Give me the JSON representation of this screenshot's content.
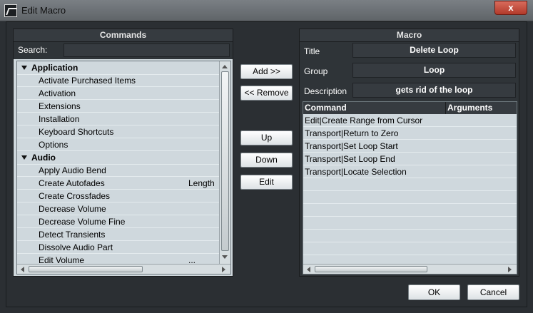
{
  "window": {
    "title": "Edit Macro",
    "close_glyph": "x"
  },
  "commands": {
    "header": "Commands",
    "search_label": "Search:",
    "search_value": "",
    "rows": [
      {
        "type": "category",
        "label": "Application",
        "arg": ""
      },
      {
        "type": "item",
        "label": "Activate Purchased Items",
        "arg": ""
      },
      {
        "type": "item",
        "label": "Activation",
        "arg": ""
      },
      {
        "type": "item",
        "label": "Extensions",
        "arg": ""
      },
      {
        "type": "item",
        "label": "Installation",
        "arg": ""
      },
      {
        "type": "item",
        "label": "Keyboard Shortcuts",
        "arg": ""
      },
      {
        "type": "item",
        "label": "Options",
        "arg": ""
      },
      {
        "type": "category",
        "label": "Audio",
        "arg": ""
      },
      {
        "type": "item",
        "label": "Apply Audio Bend",
        "arg": ""
      },
      {
        "type": "item",
        "label": "Create Autofades",
        "arg": "Length"
      },
      {
        "type": "item",
        "label": "Create Crossfades",
        "arg": ""
      },
      {
        "type": "item",
        "label": "Decrease Volume",
        "arg": ""
      },
      {
        "type": "item",
        "label": "Decrease Volume Fine",
        "arg": ""
      },
      {
        "type": "item",
        "label": "Detect Transients",
        "arg": ""
      },
      {
        "type": "item",
        "label": "Dissolve Audio Part",
        "arg": ""
      },
      {
        "type": "item",
        "label": "Edit Volume",
        "arg": "..."
      }
    ]
  },
  "buttons": {
    "add": "Add >>",
    "remove": "<< Remove",
    "up": "Up",
    "down": "Down",
    "edit": "Edit",
    "ok": "OK",
    "cancel": "Cancel"
  },
  "macro": {
    "header": "Macro",
    "title_label": "Title",
    "title_value": "Delete Loop",
    "group_label": "Group",
    "group_value": "Loop",
    "description_label": "Description",
    "description_value": "gets rid of the loop",
    "columns": {
      "command": "Command",
      "arguments": "Arguments"
    },
    "commands": [
      {
        "command": "Edit|Create Range from Cursor",
        "arguments": ""
      },
      {
        "command": "Transport|Return to Zero",
        "arguments": ""
      },
      {
        "command": "Transport|Set Loop Start",
        "arguments": ""
      },
      {
        "command": "Transport|Set Loop End",
        "arguments": ""
      },
      {
        "command": "Transport|Locate Selection",
        "arguments": ""
      }
    ],
    "empty_rows": 7
  }
}
